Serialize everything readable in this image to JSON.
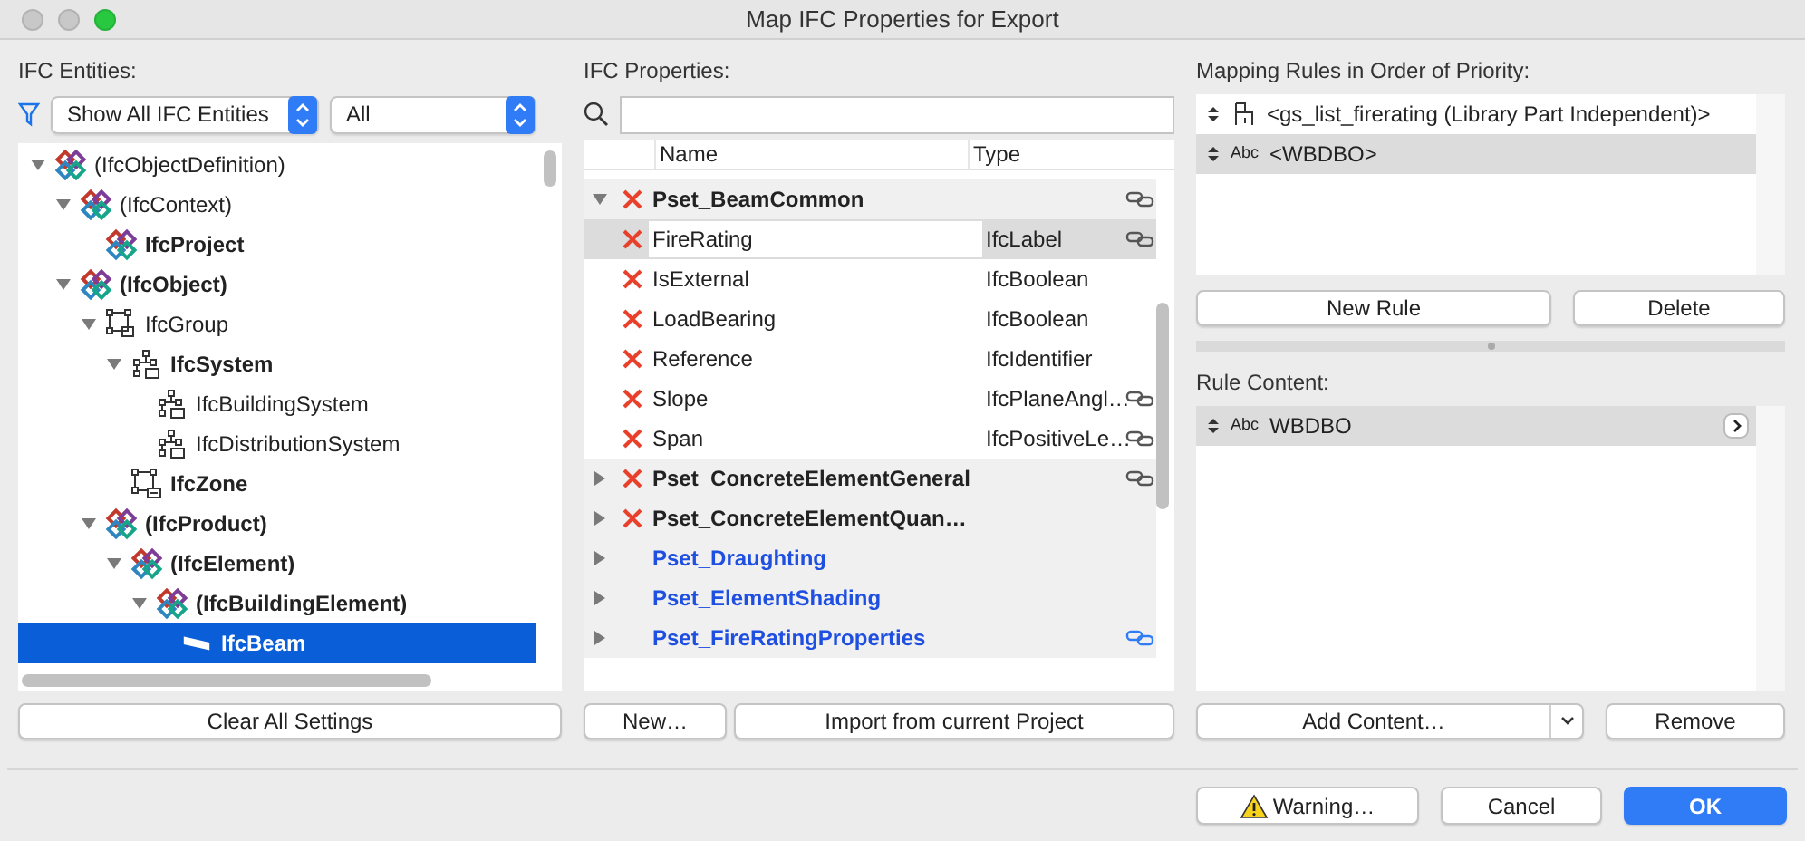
{
  "window": {
    "title": "Map IFC Properties for Export"
  },
  "entities": {
    "label": "IFC Entities:",
    "filter": {
      "value": "Show All IFC Entities"
    },
    "scope": {
      "value": "All"
    },
    "tree": [
      {
        "label": "(IfcObjectDefinition)",
        "kind": "ifc",
        "bold": false,
        "selected": false,
        "expanded": true,
        "children": [
          {
            "label": "(IfcContext)",
            "kind": "ifc",
            "bold": false,
            "selected": false,
            "expanded": true,
            "children": [
              {
                "label": "IfcProject",
                "kind": "ifc",
                "bold": true,
                "selected": false
              }
            ]
          },
          {
            "label": "(IfcObject)",
            "kind": "ifc",
            "bold": true,
            "selected": false,
            "expanded": true,
            "children": [
              {
                "label": "IfcGroup",
                "kind": "group",
                "bold": false,
                "selected": false,
                "expanded": true,
                "children": [
                  {
                    "label": "IfcSystem",
                    "kind": "system",
                    "bold": true,
                    "selected": false,
                    "expanded": true,
                    "children": [
                      {
                        "label": "IfcBuildingSystem",
                        "kind": "system",
                        "bold": false,
                        "selected": false
                      },
                      {
                        "label": "IfcDistributionSystem",
                        "kind": "system",
                        "bold": false,
                        "selected": false
                      }
                    ]
                  },
                  {
                    "label": "IfcZone",
                    "kind": "zone",
                    "bold": true,
                    "selected": false
                  }
                ]
              },
              {
                "label": "(IfcProduct)",
                "kind": "ifc",
                "bold": true,
                "selected": false,
                "expanded": true,
                "children": [
                  {
                    "label": "(IfcElement)",
                    "kind": "ifc",
                    "bold": true,
                    "selected": false,
                    "expanded": true,
                    "children": [
                      {
                        "label": "(IfcBuildingElement)",
                        "kind": "ifc",
                        "bold": true,
                        "selected": false,
                        "expanded": true,
                        "children": [
                          {
                            "label": "IfcBeam",
                            "kind": "beam",
                            "bold": true,
                            "selected": true
                          }
                        ]
                      }
                    ]
                  }
                ]
              }
            ]
          }
        ]
      }
    ],
    "button": "Clear All Settings"
  },
  "properties": {
    "label": "IFC Properties:",
    "columns": [
      "Name",
      "Type"
    ],
    "rows": [
      {
        "kind": "pset",
        "name": "Pset_BeamCommon",
        "mapped": true,
        "linked": true,
        "expanded": true,
        "selected": false
      },
      {
        "kind": "property",
        "name": "FireRating",
        "type": "IfcLabel",
        "mapped": true,
        "linked": true,
        "selected": true
      },
      {
        "kind": "property",
        "name": "IsExternal",
        "type": "IfcBoolean",
        "mapped": true,
        "linked": false,
        "selected": false
      },
      {
        "kind": "property",
        "name": "LoadBearing",
        "type": "IfcBoolean",
        "mapped": true,
        "linked": false,
        "selected": false
      },
      {
        "kind": "property",
        "name": "Reference",
        "type": "IfcIdentifier",
        "mapped": true,
        "linked": false,
        "selected": false
      },
      {
        "kind": "property",
        "name": "Slope",
        "type": "IfcPlaneAngl…",
        "mapped": true,
        "linked": true,
        "selected": false
      },
      {
        "kind": "property",
        "name": "Span",
        "type": "IfcPositiveLe…",
        "mapped": true,
        "linked": true,
        "selected": false
      },
      {
        "kind": "pset",
        "name": "Pset_ConcreteElementGeneral",
        "mapped": true,
        "linked": true,
        "expanded": false,
        "selected": false
      },
      {
        "kind": "pset",
        "name": "Pset_ConcreteElementQuan…",
        "mapped": true,
        "linked": false,
        "expanded": false,
        "selected": false
      },
      {
        "kind": "pset",
        "name": "Pset_Draughting",
        "mapped": false,
        "linked": false,
        "expanded": false,
        "selected": false
      },
      {
        "kind": "pset",
        "name": "Pset_ElementShading",
        "mapped": false,
        "linked": false,
        "expanded": false,
        "selected": false
      },
      {
        "kind": "pset",
        "name": "Pset_FireRatingProperties",
        "mapped": false,
        "linked": true,
        "expanded": false,
        "selected": false
      }
    ],
    "buttons": [
      "New…",
      "Import from current Project"
    ]
  },
  "rules": {
    "label": "Mapping Rules in Order of Priority:",
    "items": [
      {
        "kind": "library-part",
        "text": "<gs_list_firerating (Library Part Independent)>",
        "selected": false
      },
      {
        "kind": "text",
        "type_label": "Abc",
        "text": "<WBDBO>",
        "selected": true
      }
    ],
    "buttons": [
      "New Rule",
      "Delete"
    ]
  },
  "content": {
    "label": "Rule Content:",
    "items": [
      {
        "kind": "text",
        "type_label": "Abc",
        "text": "WBDBO",
        "selected": true
      }
    ],
    "buttons": [
      "Add Content…",
      "Remove"
    ]
  },
  "footer": {
    "buttons": [
      {
        "label": "Warning…",
        "kind": "warning"
      },
      {
        "label": "Cancel",
        "kind": "normal"
      },
      {
        "label": "OK",
        "kind": "default"
      }
    ]
  }
}
